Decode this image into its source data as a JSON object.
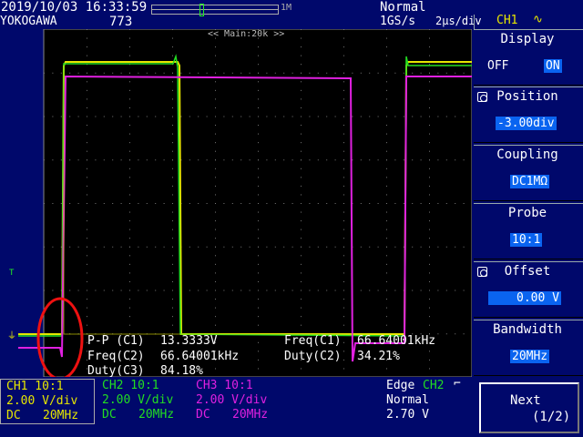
{
  "header": {
    "datetime": "2019/10/03 16:33:59",
    "brand": "YOKOGAWA",
    "count": "773",
    "record_length": "1M",
    "trigger_mode": "Normal",
    "sample_rate": "1GS/s",
    "timebase": "2µs/div"
  },
  "screen": {
    "zoom_label": "<< Main:20k >>"
  },
  "measurements": [
    {
      "label": "P-P (C1)",
      "value": "13.3333V"
    },
    {
      "label": "Freq(C2)",
      "value": "66.64001kHz"
    },
    {
      "label": "Duty(C3)",
      "value": "84.18%"
    },
    {
      "label": "Freq(C1)",
      "value": "66.64001kHz"
    },
    {
      "label": "Duty(C2)",
      "value": "34.21%"
    }
  ],
  "channels": [
    {
      "name": "CH1 10:1",
      "scale": "2.00 V/div",
      "coupling": "DC",
      "bw": "20MHz"
    },
    {
      "name": "CH2 10:1",
      "scale": "2.00 V/div",
      "coupling": "DC",
      "bw": "20MHz"
    },
    {
      "name": "CH3 10:1",
      "scale": "2.00 V/div",
      "coupling": "DC",
      "bw": "20MHz"
    }
  ],
  "trigger": {
    "type": "Edge",
    "source": "CH2",
    "mode": "Normal",
    "level": "2.70 V"
  },
  "menu": {
    "channel": "CH1",
    "display": {
      "title": "Display",
      "off": "OFF",
      "on": "ON"
    },
    "position": {
      "title": "Position",
      "value": "-3.00div"
    },
    "coupling": {
      "title": "Coupling",
      "value": "DC1MΩ"
    },
    "probe": {
      "title": "Probe",
      "value": "10:1"
    },
    "offset": {
      "title": "Offset",
      "value": "0.00 V"
    },
    "bandwidth": {
      "title": "Bandwidth",
      "value": "20MHz"
    },
    "next": {
      "label": "Next",
      "page": "(1/2)"
    }
  },
  "colors": {
    "ch1": "#e6e600",
    "ch2": "#22dd22",
    "ch3": "#e020e0",
    "background": "#00086b",
    "highlight": "#0a64f0",
    "annotation": "#ee1111"
  }
}
